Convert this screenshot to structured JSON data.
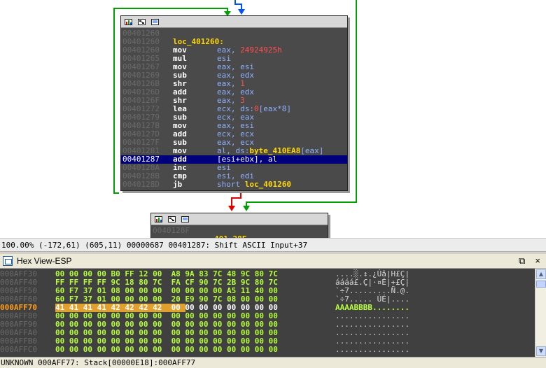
{
  "colors": {
    "node_background": "#4a4a4a",
    "mnemonic": "#ffffff",
    "operand": "#8fb0ff",
    "number": "#ff5050",
    "label": "#ffd700",
    "selection": "#00007c",
    "edge_green": "#00a000",
    "edge_blue": "#0050ff",
    "edge_red": "#e00000",
    "hex_bytes": "#b4ff37",
    "hex_highlight": "#e0a030",
    "hex_current_address": "#ff9c1a"
  },
  "graph": {
    "node_main": {
      "header_icons": [
        "graph-color-icon",
        "graph-node-icon",
        "graph-text-icon"
      ],
      "lines": [
        {
          "addr": "00401260",
          "mn": "",
          "ops": ""
        },
        {
          "addr": "00401260",
          "label": "loc_401260:"
        },
        {
          "addr": "00401260",
          "mn": "mov",
          "ops": "eax, ",
          "num": "24924925h"
        },
        {
          "addr": "00401265",
          "mn": "mul",
          "ops": "esi"
        },
        {
          "addr": "00401267",
          "mn": "mov",
          "ops": "eax, esi"
        },
        {
          "addr": "00401269",
          "mn": "sub",
          "ops": "eax, edx"
        },
        {
          "addr": "0040126B",
          "mn": "shr",
          "ops": "eax, ",
          "num": "1"
        },
        {
          "addr": "0040126D",
          "mn": "add",
          "ops": "eax, edx"
        },
        {
          "addr": "0040126F",
          "mn": "shr",
          "ops": "eax, ",
          "num": "3"
        },
        {
          "addr": "00401272",
          "mn": "lea",
          "ops": "ecx, ds:",
          "num": "0",
          "ops2": "[eax*8]"
        },
        {
          "addr": "00401279",
          "mn": "sub",
          "ops": "ecx, eax"
        },
        {
          "addr": "0040127B",
          "mn": "mov",
          "ops": "eax, esi"
        },
        {
          "addr": "0040127D",
          "mn": "add",
          "ops": "ecx, ecx"
        },
        {
          "addr": "0040127F",
          "mn": "sub",
          "ops": "eax, ecx"
        },
        {
          "addr": "00401281",
          "mn": "mov",
          "ops": "al, ds:",
          "ref": "byte_410EA8",
          "ops2": "[eax]"
        },
        {
          "addr": "00401287",
          "mn": "add",
          "ops": "[esi+ebx], al",
          "selected": true
        },
        {
          "addr": "0040128A",
          "mn": "inc",
          "ops": "esi"
        },
        {
          "addr": "0040128B",
          "mn": "cmp",
          "ops": "esi, edi"
        },
        {
          "addr": "0040128D",
          "mn": "jb",
          "ops": "short ",
          "ref": "loc_401260"
        }
      ]
    },
    "node_next": {
      "header_icons": [
        "graph-color-icon",
        "graph-node-icon",
        "graph-text-icon"
      ],
      "lines": [
        {
          "addr": "0040128F",
          "mn": "",
          "ops": ""
        }
      ],
      "partial_text": "401 28F"
    }
  },
  "status_bar": {
    "zoom": "100.00%",
    "coords1": "(-172,61)",
    "coords2": "(605,11)",
    "offset": "00000687",
    "info": "00401287: Shift ASCII Input+37"
  },
  "hex_view": {
    "title": "Hex View-ESP",
    "restore_glyph": "⧉",
    "close_glyph": "×",
    "rows": [
      {
        "addr": "000AFF30",
        "bytes": "00 00 00 00 B0 FF 12 00  A8 9A 83 7C 48 9C 80 7C",
        "ascii": "....░.↕.¿Úâ|H£Ç|"
      },
      {
        "addr": "000AFF40",
        "bytes": "FF FF FF FF 9C 18 80 7C  FA CF 90 7C 2B 9C 80 7C",
        "ascii": "áááá£.Ç|·¤É|+£Ç|"
      },
      {
        "addr": "000AFF50",
        "bytes": "60 F7 37 01 08 00 00 00  00 00 00 00 A5 11 40 00",
        "ascii": "`÷7.........Ñ.@."
      },
      {
        "addr": "000AFF60",
        "bytes": "60 F7 37 01 00 00 00 00  20 E9 90 7C 08 00 00 00",
        "ascii": "`÷7..... ÚÉ|...."
      },
      {
        "addr": "000AFF70",
        "bytes": "41 41 41 41 42 42 42 42  00 00 00 00 00 00 00 00",
        "ascii": "AAAABBBB........",
        "current": true
      },
      {
        "addr": "000AFF80",
        "bytes": "00 00 00 00 00 00 00 00  00 00 00 00 00 00 00 00",
        "ascii": "................"
      },
      {
        "addr": "000AFF90",
        "bytes": "00 00 00 00 00 00 00 00  00 00 00 00 00 00 00 00",
        "ascii": "................"
      },
      {
        "addr": "000AFFA0",
        "bytes": "00 00 00 00 00 00 00 00  00 00 00 00 00 00 00 00",
        "ascii": "................"
      },
      {
        "addr": "000AFFB0",
        "bytes": "00 00 00 00 00 00 00 00  00 00 00 00 00 00 00 00",
        "ascii": "................"
      },
      {
        "addr": "000AFFC0",
        "bytes": "00 00 00 00 00 00 00 00  00 00 00 00 00 00 00 00",
        "ascii": "................"
      }
    ],
    "status": "UNKNOWN 000AFF77: Stack[00000E18]:000AFF77"
  }
}
